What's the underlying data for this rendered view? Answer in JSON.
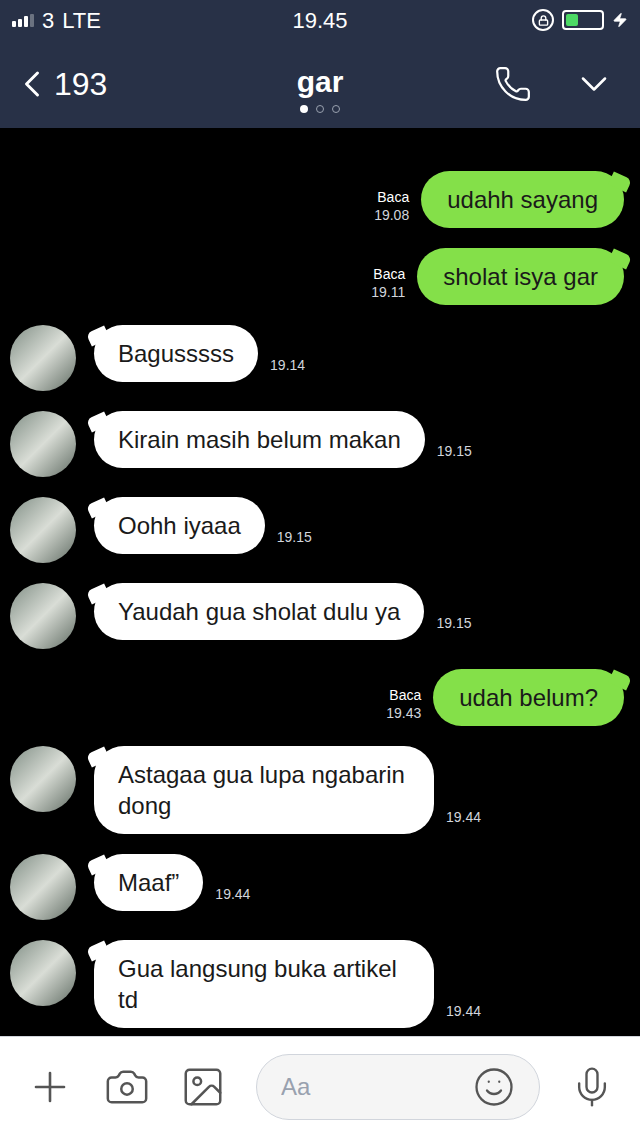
{
  "status_bar": {
    "carrier": "3",
    "network": "LTE",
    "time": "19.45",
    "signal_level": 0.75,
    "battery_level": 0.35,
    "charging": true
  },
  "header": {
    "back_label": "193",
    "title": "gar",
    "pages": [
      {
        "selected": true
      },
      {
        "selected": false
      },
      {
        "selected": false
      }
    ]
  },
  "messages": [
    {
      "kind": "sent",
      "text": "udahh sayang",
      "read_label": "Baca",
      "time": "19.08"
    },
    {
      "kind": "sent",
      "text": "sholat isya gar",
      "read_label": "Baca",
      "time": "19.11"
    },
    {
      "kind": "received",
      "text": "Bagusssss",
      "time": "19.14"
    },
    {
      "kind": "received",
      "text": "Kirain masih belum makan",
      "time": "19.15"
    },
    {
      "kind": "received",
      "text": "Oohh iyaaa",
      "time": "19.15"
    },
    {
      "kind": "received",
      "text": "Yaudah gua sholat dulu ya",
      "time": "19.15"
    },
    {
      "kind": "sent",
      "text": "udah belum?",
      "read_label": "Baca",
      "time": "19.43"
    },
    {
      "kind": "received",
      "text": "Astagaa gua lupa ngabarin dong",
      "time": "19.44"
    },
    {
      "kind": "received",
      "text": "Maaf”",
      "time": "19.44"
    },
    {
      "kind": "received",
      "text": "Gua langsung buka artikel td",
      "time": "19.44"
    }
  ],
  "composer": {
    "placeholder": "Aa"
  }
}
